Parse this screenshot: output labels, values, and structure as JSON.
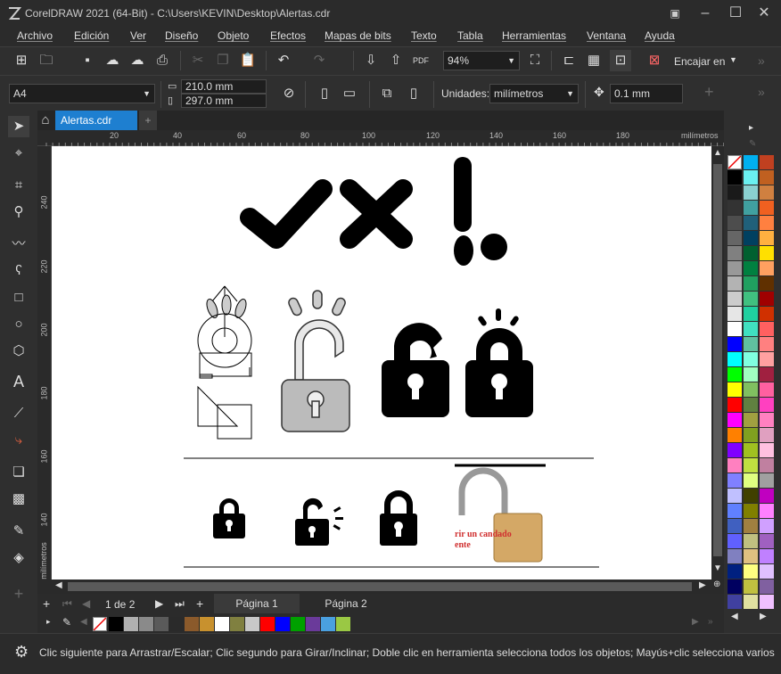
{
  "window": {
    "title": "CorelDRAW 2021 (64-Bit) - C:\\Users\\KEVIN\\Desktop\\Alertas.cdr"
  },
  "menu": [
    "Archivo",
    "Edición",
    "Ver",
    "Diseño",
    "Objeto",
    "Efectos",
    "Mapas de bits",
    "Texto",
    "Tabla",
    "Herramientas",
    "Ventana",
    "Ayuda"
  ],
  "toolbar": {
    "zoom": "94%",
    "snap_label": "Encajar en"
  },
  "propbar": {
    "paper": "A4",
    "width": "210.0 mm",
    "height": "297.0 mm",
    "units_label": "Unidades:",
    "units": "milímetros",
    "nudge": "0.1 mm"
  },
  "doc": {
    "tab": "Alertas.cdr"
  },
  "ruler": {
    "h_ticks": [
      "20",
      "40",
      "60",
      "80",
      "100",
      "120",
      "140",
      "160",
      "180"
    ],
    "h_unit": "milímetros",
    "v_ticks": [
      "240",
      "220",
      "200",
      "180",
      "160",
      "140"
    ],
    "v_unit": "milímetros"
  },
  "canvas": {
    "lock_text_line1": "rir un candado",
    "lock_text_line2": "ente"
  },
  "pager": {
    "page_count": "1 de 2",
    "pages": [
      "Página 1",
      "Página 2"
    ]
  },
  "status": {
    "text": "Clic siguiente para Arrastrar/Escalar; Clic segundo para Girar/Inclinar; Doble clic en herramienta selecciona todos los objetos; Mayús+clic selecciona varios o"
  },
  "colors": {
    "accent": "#1e7fd0",
    "page": "#ffffff",
    "bg": "#2b2b2b"
  },
  "palette_bottom": [
    "#000000",
    "#b0b0b0",
    "#8a8a8a",
    "#5a5a5a",
    "#2a2a2a",
    "#8b5a2b",
    "#c8912e",
    "#ffffff",
    "#808040",
    "#c8c8c8",
    "#ff0000",
    "#0000ff",
    "#00a000",
    "#6a3a9a",
    "#4aa0e0",
    "#9ac844"
  ],
  "palette_right": [
    [
      "#00b0f0",
      "#c04020"
    ],
    [
      "#000000",
      "#6af0f0",
      "#c06020"
    ],
    [
      "#1a1a1a",
      "#8ad0d0",
      "#d08040"
    ],
    [
      "#333333",
      "#40a0a0",
      "#f06020"
    ],
    [
      "#4d4d4d",
      "#20607a",
      "#ff8040"
    ],
    [
      "#666666",
      "#004060",
      "#ffb040"
    ],
    [
      "#808080",
      "#006030",
      "#ffe000"
    ],
    [
      "#999999",
      "#008040",
      "#ffa060"
    ],
    [
      "#b3b3b3",
      "#20a060",
      "#603000"
    ],
    [
      "#cccccc",
      "#40c080",
      "#a00000"
    ],
    [
      "#e6e6e6",
      "#20d0a0",
      "#d03000"
    ],
    [
      "#ffffff",
      "#40e0c0",
      "#ff6060"
    ],
    [
      "#0000ff",
      "#60c0a0",
      "#ff8080"
    ],
    [
      "#00ffff",
      "#80ffe0",
      "#ffa0a0"
    ],
    [
      "#00ff00",
      "#a0ffc0",
      "#a02040"
    ],
    [
      "#ffff00",
      "#80c060",
      "#ff60a0"
    ],
    [
      "#ff0000",
      "#608040",
      "#ff40c0"
    ],
    [
      "#ff00ff",
      "#a0a040",
      "#ff80c0"
    ],
    [
      "#ff8000",
      "#80a020",
      "#e0a0c0"
    ],
    [
      "#8000ff",
      "#a0c020",
      "#ffc0e0"
    ],
    [
      "#ff80c0",
      "#c0e040",
      "#c080a0"
    ],
    [
      "#8080ff",
      "#e0ff80",
      "#a0a0a0"
    ],
    [
      "#c0c0ff",
      "#404000",
      "#c000c0"
    ],
    [
      "#6080ff",
      "#808000",
      "#ff80ff"
    ],
    [
      "#4060c0",
      "#a08040",
      "#d0a0ff"
    ],
    [
      "#6060ff",
      "#c0c080",
      "#a060c0"
    ],
    [
      "#8080c0",
      "#e0c080",
      "#c080ff"
    ],
    [
      "#002080",
      "#ffff80",
      "#e0c0ff"
    ],
    [
      "#000060",
      "#c0c040",
      "#8060a0"
    ],
    [
      "#4040a0",
      "#e0e0a0",
      "#f0c0ff"
    ]
  ]
}
